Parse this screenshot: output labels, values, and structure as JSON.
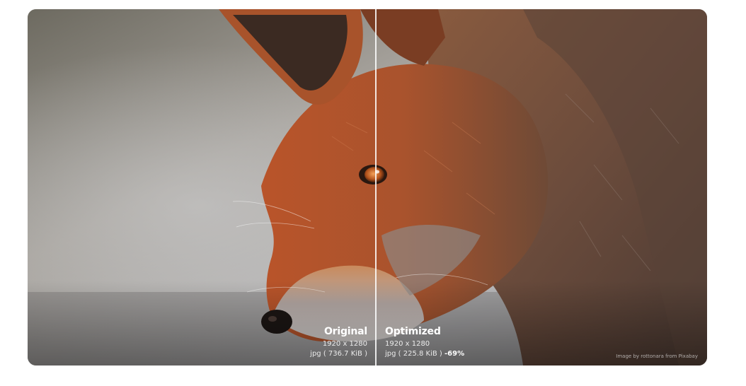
{
  "original": {
    "title": "Original",
    "dimensions": "1920 x 1280",
    "file_info": "jpg ( 736.7 KiB )"
  },
  "optimized": {
    "title": "Optimized",
    "dimensions": "1920 x 1280",
    "file_info": "jpg ( 225.8 KiB )",
    "savings": "-69%"
  },
  "credit": "Image by rottonara from Pixabay",
  "slider": {
    "position_percent": 51.3
  }
}
